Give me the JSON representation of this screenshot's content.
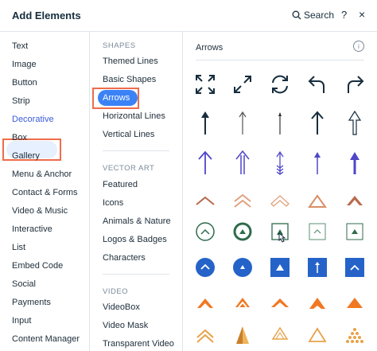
{
  "header": {
    "title": "Add Elements",
    "search_label": "Search",
    "help_icon": "?",
    "close_icon": "×"
  },
  "categories": [
    "Text",
    "Image",
    "Button",
    "Strip",
    "Decorative",
    "Box",
    "Gallery",
    "Menu & Anchor",
    "Contact & Forms",
    "Video & Music",
    "Interactive",
    "List",
    "Embed Code",
    "Social",
    "Payments",
    "Input",
    "Content Manager"
  ],
  "selected_category": "Decorative",
  "subcategories": {
    "shapes_heading": "SHAPES",
    "shapes": [
      "Themed Lines",
      "Basic Shapes",
      "Arrows",
      "Horizontal Lines",
      "Vertical Lines"
    ],
    "vector_heading": "VECTOR ART",
    "vector": [
      "Featured",
      "Icons",
      "Animals & Nature",
      "Logos & Badges",
      "Characters"
    ],
    "video_heading": "VIDEO",
    "video": [
      "VideoBox",
      "Video Mask",
      "Transparent Video"
    ]
  },
  "selected_subcategory": "Arrows",
  "gallery": {
    "section_title": "Arrows",
    "info_icon": "i"
  },
  "colors": {
    "accent_blue": "#3b82f6",
    "dark_blue": "#2563c9",
    "purple": "#4f46c8",
    "brown": "#b86a4b",
    "green": "#2e6b4b",
    "orange": "#f07822",
    "gold": "#e8a24a",
    "highlight": "#ef6c4b"
  },
  "icons": [
    "expand-arrows-icon",
    "diagonal-expand-icon",
    "refresh-icon",
    "undo-arrow-icon",
    "redo-arrow-icon",
    "thick-up-arrow-icon",
    "thin-up-arrow-icon",
    "thin-up-arrow-2-icon",
    "bold-up-arrow-icon",
    "outline-up-arrow-icon",
    "purple-up-arrow-icon",
    "purple-double-line-arrow-icon",
    "purple-feather-arrow-icon",
    "purple-thin-arrow-icon",
    "purple-bold-arrow-icon",
    "brown-chevron-icon",
    "brown-double-chevron-icon",
    "brown-outline-chevron-icon",
    "brown-triangle-outline-icon",
    "brown-chevron-up-icon",
    "green-circle-chevron-icon",
    "green-circle-triangle-icon",
    "green-square-triangle-icon",
    "green-square-outline-chevron-icon",
    "green-square-triangle-2-icon",
    "blue-circle-chevron-icon",
    "blue-circle-triangle-icon",
    "blue-square-triangle-icon",
    "blue-square-arrow-icon",
    "blue-square-chevron-icon",
    "orange-triangle-icon",
    "orange-double-chevron-icon",
    "orange-chevron-icon",
    "orange-arrow-triangle-icon",
    "orange-triangle-2-icon",
    "gold-double-chevron-icon",
    "gold-pyramid-icon",
    "gold-diamond-icon",
    "gold-triangle-outline-icon",
    "gold-dots-triangle-icon"
  ]
}
